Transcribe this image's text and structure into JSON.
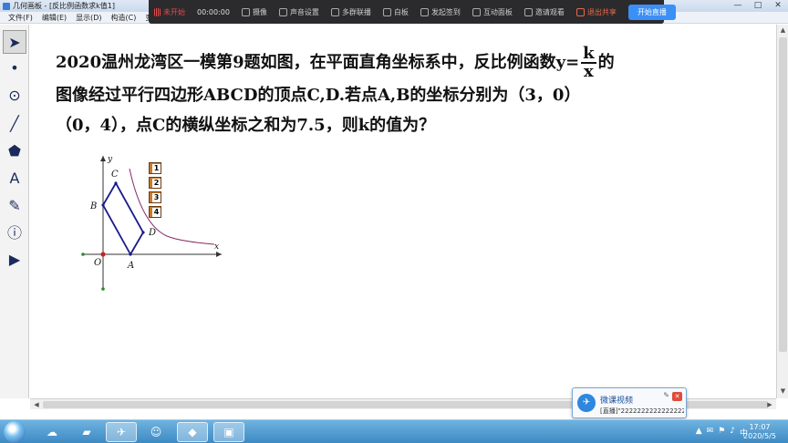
{
  "window": {
    "title": "几何画板 - [反比例函数求k值1]",
    "controls": [
      "—",
      "□",
      "✕"
    ]
  },
  "menu": [
    "文件(F)",
    "编辑(E)",
    "显示(D)",
    "构造(C)",
    "变"
  ],
  "recording": {
    "status": "未开始",
    "time": "00:00:00",
    "items": [
      "摄像",
      "声音设置",
      "多群联播",
      "白板",
      "发起签到",
      "互动面板",
      "邀请观看"
    ],
    "exit": "退出共享",
    "start_live": "开始直播"
  },
  "tools": [
    {
      "icon": "arrow-select-icon",
      "glyph": "➤"
    },
    {
      "icon": "point-tool-icon",
      "glyph": "•"
    },
    {
      "icon": "compass-tool-icon",
      "glyph": "⊙"
    },
    {
      "icon": "line-tool-icon",
      "glyph": "╱"
    },
    {
      "icon": "polygon-tool-icon",
      "glyph": "⬟"
    },
    {
      "icon": "text-tool-icon",
      "glyph": "A"
    },
    {
      "icon": "marker-tool-icon",
      "glyph": "✎"
    },
    {
      "icon": "info-tool-icon",
      "glyph": "ⓘ"
    },
    {
      "icon": "custom-tool-icon",
      "glyph": "▶"
    }
  ],
  "question": {
    "part1": "2020温州龙湾区一模第9题如图，在平面直角坐标系中，反比例函数y=",
    "frac_num": "k",
    "frac_den": "x",
    "part2": "的",
    "line2": "图像经过平行四边形ABCD的顶点C,D.若点A,B的坐标分别为（3，0）",
    "line3": "（0，4），点C的横纵坐标之和为7.5，则k的值为？"
  },
  "figure": {
    "labels": {
      "x": "x",
      "y": "y",
      "O": "O",
      "A": "A",
      "B": "B",
      "C": "C",
      "D": "D"
    },
    "colors": {
      "parallelogram": "#1a1a8c",
      "curve": "#8a2a6a",
      "axis": "#333333",
      "origin": "#cc2222",
      "point": "#2a8a2a"
    }
  },
  "buttons": [
    "1",
    "2",
    "3",
    "4"
  ],
  "popup": {
    "title": "微课视频",
    "text": "[直播]\"2222222222222222",
    "close": "✕"
  },
  "clock": {
    "time": "17:07",
    "date": "2020/5/5"
  },
  "tray": [
    "▲",
    "✉",
    "⚑",
    "♪",
    "中"
  ]
}
